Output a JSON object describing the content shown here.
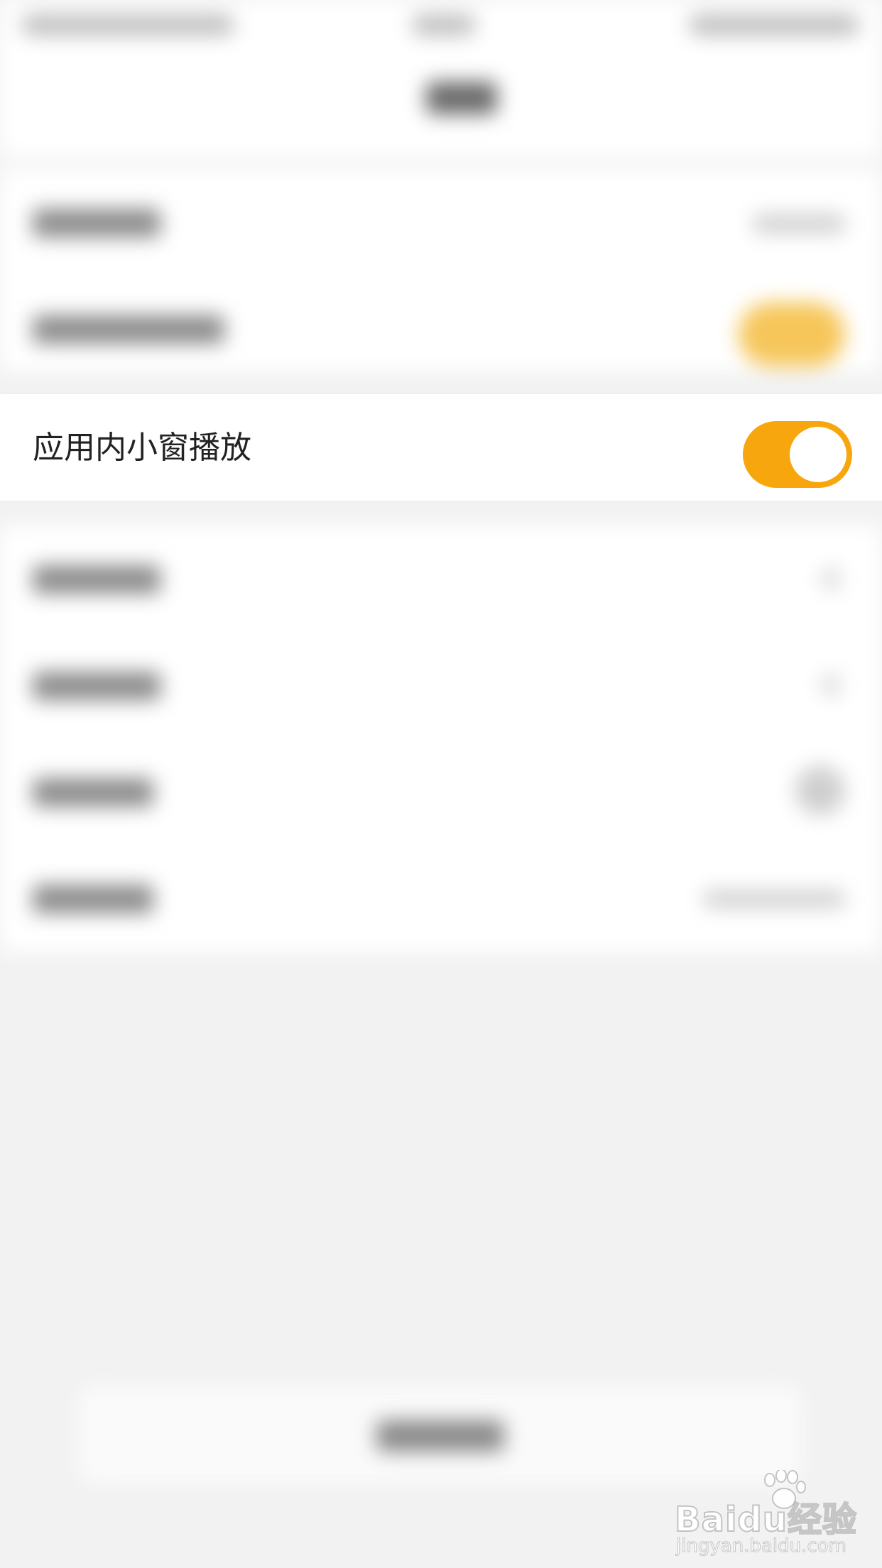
{
  "settings_row": {
    "label": "应用内小窗播放",
    "toggle_on": true
  },
  "colors": {
    "accent": "#f8a60e",
    "background": "#f2f2f2",
    "card": "#ffffff",
    "text": "#222222"
  },
  "watermark": {
    "brand": "Baidu经验",
    "url": "jingyan.baidu.com"
  }
}
